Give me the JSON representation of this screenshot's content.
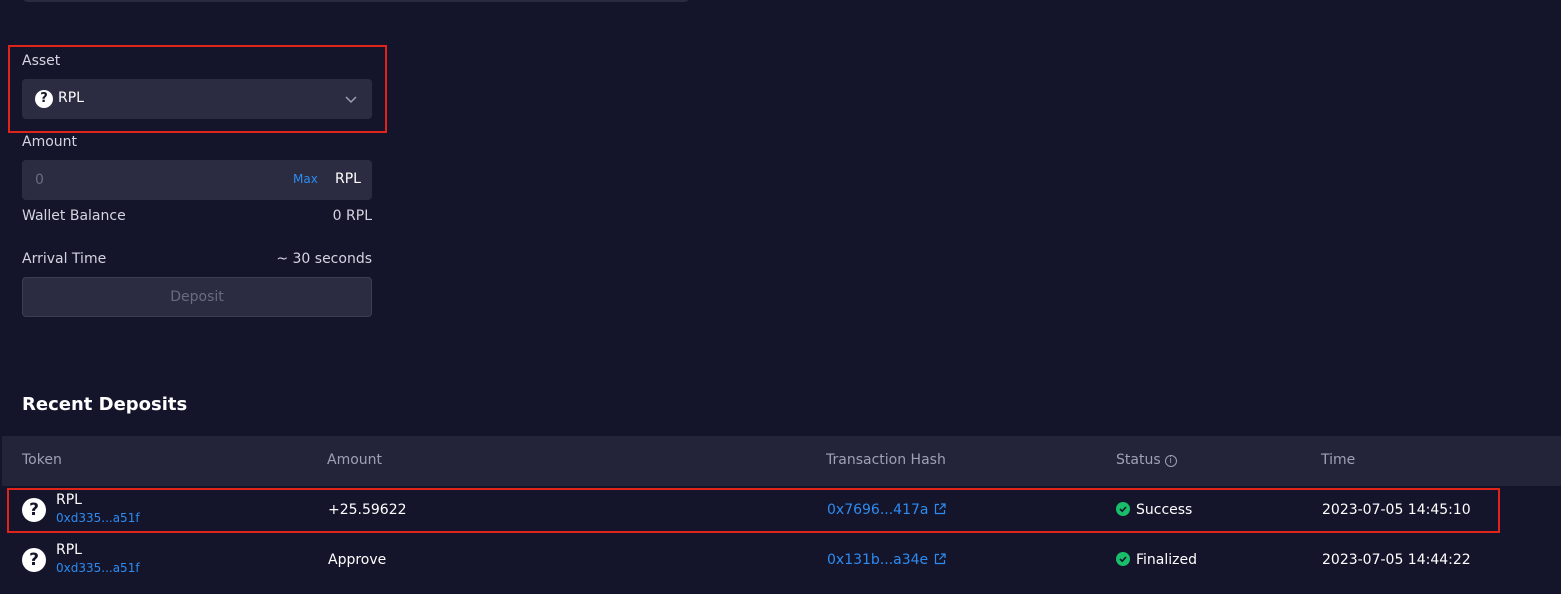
{
  "form": {
    "asset_label": "Asset",
    "asset_selected": "RPL",
    "amount_label": "Amount",
    "amount_placeholder": "0",
    "max_label": "Max",
    "amount_unit": "RPL",
    "wallet_balance_label": "Wallet Balance",
    "wallet_balance_value": "0 RPL",
    "arrival_time_label": "Arrival Time",
    "arrival_time_value": "~ 30 seconds",
    "deposit_button": "Deposit"
  },
  "recent": {
    "title": "Recent Deposits",
    "columns": [
      "Token",
      "Amount",
      "Transaction Hash",
      "Status",
      "Time"
    ],
    "rows": [
      {
        "token": "RPL",
        "address": "0xd335...a51f",
        "amount": "+25.59622",
        "hash": "0x7696...417a",
        "status": "Success",
        "time": "2023-07-05 14:45:10"
      },
      {
        "token": "RPL",
        "address": "0xd335...a51f",
        "amount": "Approve",
        "hash": "0x131b...a34e",
        "status": "Finalized",
        "time": "2023-07-05 14:44:22"
      }
    ]
  },
  "colors": {
    "background": "#14142b",
    "panel": "#2b2b41",
    "accent": "#2d8cf0",
    "success": "#19be6b",
    "highlight": "#e0241a"
  },
  "icons": [
    "question-icon",
    "chevron-down-icon",
    "info-icon",
    "external-link-icon",
    "check-circle-icon"
  ]
}
